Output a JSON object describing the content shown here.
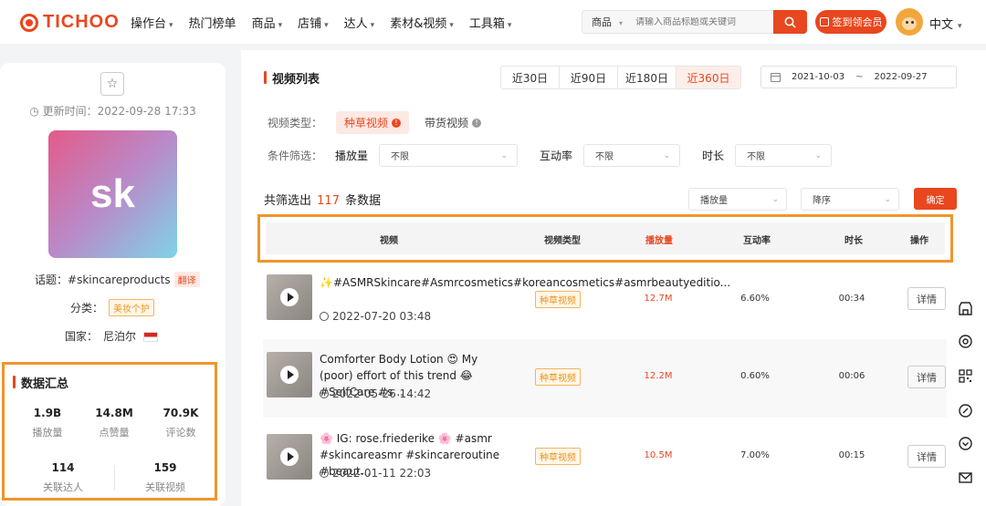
{
  "header": {
    "logo": "TICHOO",
    "nav": [
      {
        "label": "操作台",
        "dropdown": true
      },
      {
        "label": "热门榜单",
        "dropdown": false
      },
      {
        "label": "商品",
        "dropdown": true
      },
      {
        "label": "店铺",
        "dropdown": true
      },
      {
        "label": "达人",
        "dropdown": true
      },
      {
        "label": "素材&视频",
        "dropdown": true
      },
      {
        "label": "工具箱",
        "dropdown": true
      }
    ],
    "search": {
      "category": "商品",
      "placeholder": "请输入商品标题或关键词"
    },
    "vip_button": "签到领会员",
    "language": "中文"
  },
  "profile": {
    "updated": "更新时间：2022-09-28 17:33",
    "logo_text": "sk",
    "topic_label": "话题：",
    "topic_value": "#skincareproducts",
    "translate": "翻译",
    "category_label": "分类：",
    "category_value": "美妆个护",
    "country_label": "国家：",
    "country_value": "尼泊尔"
  },
  "summary": {
    "title": "数据汇总",
    "stats": [
      {
        "value": "1.9B",
        "label": "播放量"
      },
      {
        "value": "14.8M",
        "label": "点赞量"
      },
      {
        "value": "70.9K",
        "label": "评论数"
      },
      {
        "value": "114",
        "label": "关联达人"
      },
      {
        "value": "159",
        "label": "关联视频"
      }
    ]
  },
  "videos": {
    "title": "视频列表",
    "ranges": [
      "近30日",
      "近90日",
      "近180日",
      "近360日"
    ],
    "active_range": "近360日",
    "date_start": "2021-10-03",
    "date_sep": "~",
    "date_end": "2022-09-27",
    "type_label": "视频类型：",
    "types": [
      "种草视频",
      "带货视频"
    ],
    "filter_label": "条件筛选：",
    "filters": [
      {
        "label": "播放量",
        "value": "不限"
      },
      {
        "label": "互动率",
        "value": "不限"
      },
      {
        "label": "时长",
        "value": "不限"
      }
    ],
    "count_prefix": "共筛选出",
    "count": "117",
    "count_suffix": "条数据",
    "sort_field": "播放量",
    "sort_order": "降序",
    "confirm": "确定",
    "columns": [
      "视频",
      "视频类型",
      "播放量",
      "互动率",
      "时长",
      "操作"
    ],
    "rows": [
      {
        "title": "✨#ASMRSkincare#Asmrcosmetics#koreancosmetics#asmrbeautyeditio...",
        "date": "2022-07-20 03:48",
        "type": "种草视频",
        "plays": "12.7M",
        "rate": "6.60%",
        "duration": "00:34",
        "action": "详情"
      },
      {
        "title": "Comforter Body Lotion 😍 My (poor) effort of this trend 😂 #SelfCare #s...",
        "date": "2022-05-26 14:42",
        "type": "种草视频",
        "plays": "12.2M",
        "rate": "0.60%",
        "duration": "00:06",
        "action": "详情"
      },
      {
        "title": "🌸 IG: rose.friederike 🌸 #asmr #skincareasmr #skincareroutine #beaut...",
        "date": "2022-01-11 22:03",
        "type": "种草视频",
        "plays": "10.5M",
        "rate": "7.00%",
        "duration": "00:15",
        "action": "详情"
      }
    ]
  },
  "colors": {
    "accent": "#e8471f",
    "highlight_border": "#f0952c",
    "tag": "#e8951f"
  },
  "rail_icons": [
    "shop-icon",
    "target-icon",
    "qrcode-icon",
    "link-icon",
    "heart-icon",
    "mail-icon"
  ]
}
